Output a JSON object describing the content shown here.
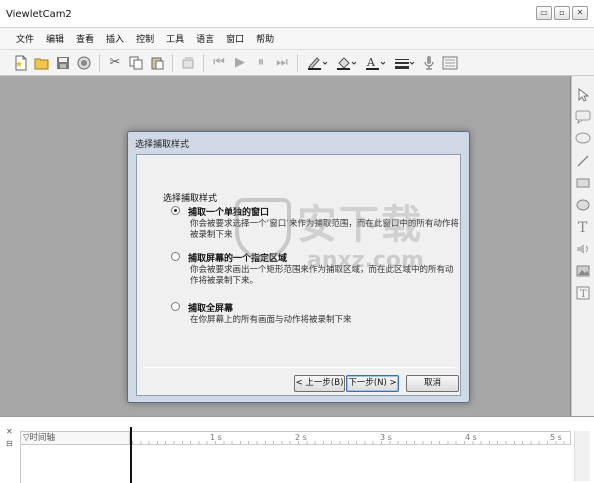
{
  "window": {
    "title": "ViewletCam2",
    "buttons": [
      "▭",
      "▫",
      "✕"
    ]
  },
  "menu": [
    "文件",
    "编辑",
    "查看",
    "插入",
    "控制",
    "工具",
    "语言",
    "窗口",
    "帮助"
  ],
  "toolbar": [
    "new-icon",
    "open-icon",
    "save-icon",
    "record-icon",
    "cut-icon",
    "copy-icon",
    "paste-icon",
    "undo-icon",
    "first-frame-icon",
    "play-icon",
    "pause-icon",
    "last-frame-icon",
    "line-color-icon",
    "fill-color-icon",
    "text-color-icon",
    "line-style-icon",
    "microphone-icon",
    "properties-icon"
  ],
  "right_tools": [
    "pointer-icon",
    "callout-icon",
    "speech-icon",
    "line-icon",
    "rectangle-icon",
    "ellipse-icon",
    "text-icon",
    "sound-icon",
    "image-icon",
    "text-box-icon"
  ],
  "dialog": {
    "title": "选择捕取样式",
    "heading": "选择捕取样式",
    "options": [
      {
        "label": "捕取一个单独的窗口",
        "desc": "你会被要求选择一个‘窗口’来作为捕取范围，而在此窗口中的所有动作将被录制下来",
        "selected": true
      },
      {
        "label": "捕取屏幕的一个指定区域",
        "desc": "你会被要求画出一个矩形范围来作为捕取区域，而在此区域中的所有动作将被录制下来。",
        "selected": false
      },
      {
        "label": "捕取全屏幕",
        "desc": "在你屏幕上的所有画面与动作将被录制下来",
        "selected": false
      }
    ],
    "back_label": "< 上一步(B)",
    "next_label": "下一步(N) >",
    "cancel_label": "取消"
  },
  "watermark": {
    "cn": "安下载",
    "en": "anxz.com"
  },
  "timeline": {
    "close": "✕",
    "pin": "⊟",
    "label": "▽时间轴",
    "ticks": [
      "1 s",
      "2 s",
      "3 s",
      "4 s",
      "5 s"
    ]
  }
}
